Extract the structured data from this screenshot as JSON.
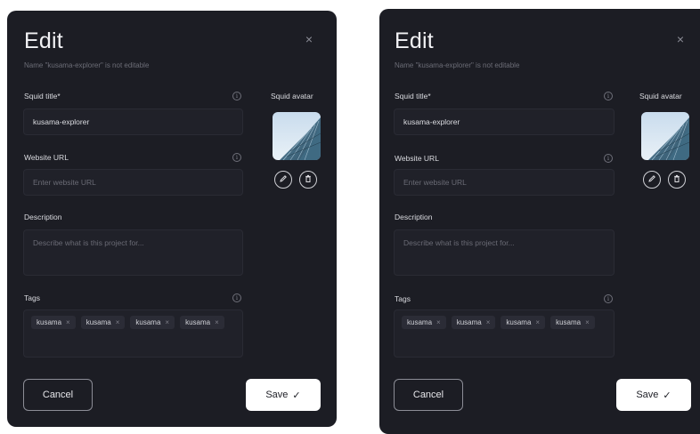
{
  "dialog": {
    "title": "Edit",
    "subtitle": "Name \"kusama-explorer\" is not editable",
    "close_icon": "×",
    "squid_title": {
      "label": "Squid title*",
      "value": "kusama-explorer"
    },
    "website_url": {
      "label": "Website URL",
      "placeholder": "Enter website URL"
    },
    "description": {
      "label": "Description",
      "placeholder": "Describe what is this project for..."
    },
    "tags": {
      "label": "Tags",
      "items": [
        "kusama",
        "kusama",
        "kusama",
        "kusama"
      ],
      "remove_icon": "×"
    },
    "avatar": {
      "label": "Squid avatar",
      "edit_icon": "pencil-icon",
      "delete_icon": "trash-icon"
    },
    "info_icon": "i",
    "cancel_label": "Cancel",
    "save_label": "Save",
    "save_icon": "✓"
  },
  "colors": {
    "modal_bg": "#1c1d24",
    "input_bg": "#202129",
    "tag_bg": "#2b2c36",
    "save_bg": "#ffffff"
  }
}
